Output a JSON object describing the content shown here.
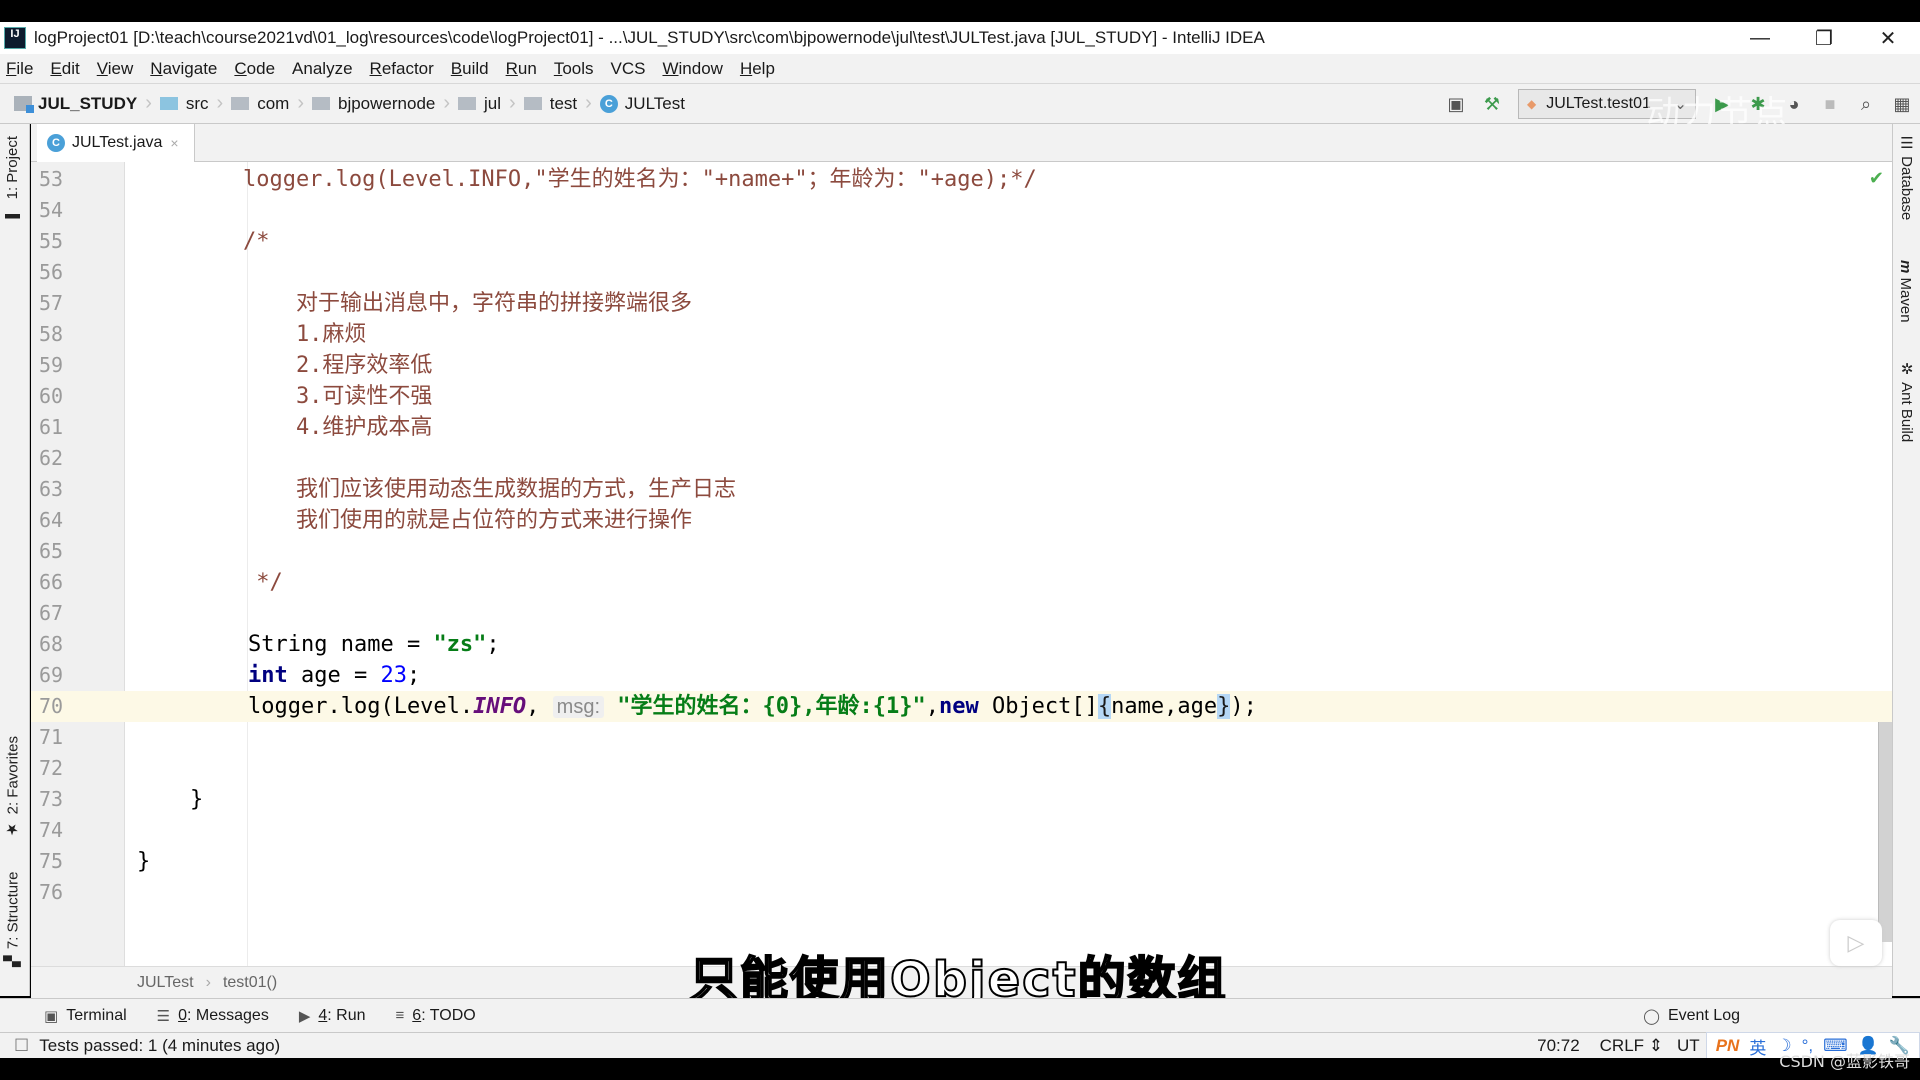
{
  "window": {
    "title": "logProject01 [D:\\teach\\course2021vd\\01_log\\resources\\code\\logProject01] - ...\\JUL_STUDY\\src\\com\\bjpowernode\\jul\\test\\JULTest.java [JUL_STUDY] - IntelliJ IDEA",
    "app_logo": "IJ",
    "controls": {
      "minimize": "—",
      "restore": "❐",
      "close": "✕"
    }
  },
  "menu": [
    {
      "label": "File",
      "mnemonic": "F",
      "rest": "ile"
    },
    {
      "label": "Edit",
      "mnemonic": "E",
      "rest": "dit"
    },
    {
      "label": "View",
      "mnemonic": "V",
      "rest": "iew"
    },
    {
      "label": "Navigate",
      "mnemonic": "N",
      "rest": "avigate"
    },
    {
      "label": "Code",
      "mnemonic": "C",
      "rest": "ode"
    },
    {
      "label": "Analyze",
      "mnemonic": "",
      "rest": "Analyze"
    },
    {
      "label": "Refactor",
      "mnemonic": "R",
      "rest": "efactor"
    },
    {
      "label": "Build",
      "mnemonic": "B",
      "rest": "uild"
    },
    {
      "label": "Run",
      "mnemonic": "R",
      "rest": "un"
    },
    {
      "label": "Tools",
      "mnemonic": "T",
      "rest": "ools"
    },
    {
      "label": "VCS",
      "mnemonic": "",
      "rest": "VCS"
    },
    {
      "label": "Window",
      "mnemonic": "W",
      "rest": "indow"
    },
    {
      "label": "Help",
      "mnemonic": "H",
      "rest": "elp"
    }
  ],
  "nav": {
    "crumbs": [
      "JUL_STUDY",
      "src",
      "com",
      "bjpowernode",
      "jul",
      "test",
      "JULTest"
    ],
    "run_config": "JULTest.test01",
    "watermark": "动力节点"
  },
  "tool_strips": {
    "left": [
      "1: Project",
      "2: Favorites",
      "7: Structure"
    ],
    "right": [
      "Database",
      "Maven",
      "Ant Build"
    ]
  },
  "editor_tab": {
    "label": "JULTest.java",
    "close": "×"
  },
  "code": {
    "current_line": 70,
    "lines": [
      {
        "n": "53",
        "text": "        logger.log(Level.INFO,\"学生的姓名为：\"+name+\"；年龄为：\"+age);*/"
      },
      {
        "n": "54",
        "text": ""
      },
      {
        "n": "55",
        "text": "        /*"
      },
      {
        "n": "56",
        "text": ""
      },
      {
        "n": "57",
        "text": "            对于输出消息中，字符串的拼接弊端很多"
      },
      {
        "n": "58",
        "text": "            1.麻烦"
      },
      {
        "n": "59",
        "text": "            2.程序效率低"
      },
      {
        "n": "60",
        "text": "            3.可读性不强"
      },
      {
        "n": "61",
        "text": "            4.维护成本高"
      },
      {
        "n": "62",
        "text": ""
      },
      {
        "n": "63",
        "text": "            我们应该使用动态生成数据的方式，生产日志"
      },
      {
        "n": "64",
        "text": "            我们使用的就是占位符的方式来进行操作"
      },
      {
        "n": "65",
        "text": ""
      },
      {
        "n": "66",
        "text": "         */"
      },
      {
        "n": "67",
        "text": ""
      },
      {
        "n": "68",
        "parts": [
          "String name = ",
          "\"zs\"",
          ";"
        ]
      },
      {
        "n": "69",
        "parts": [
          "int",
          " age = ",
          "23",
          ";"
        ]
      },
      {
        "n": "70",
        "parts": [
          "logger.log(Level.",
          "INFO",
          ", ",
          "msg:",
          " ",
          "\"学生的姓名：{0},年龄:{1}\"",
          ",",
          "new",
          " Object[]",
          "{",
          "name,age",
          "}",
          ");"
        ]
      },
      {
        "n": "71",
        "text": ""
      },
      {
        "n": "72",
        "text": ""
      },
      {
        "n": "73",
        "text": "    }"
      },
      {
        "n": "74",
        "text": ""
      },
      {
        "n": "75",
        "text": "}"
      },
      {
        "n": "76",
        "text": ""
      }
    ]
  },
  "editor_breadcrumb": {
    "class": "JULTest",
    "method": "test01()"
  },
  "subtitle": "只能使用Object的数组",
  "tool_windows": [
    {
      "num": "",
      "label": "Terminal",
      "icon": "terminal-icon"
    },
    {
      "num": "0",
      "label": ": Messages",
      "icon": "messages-icon"
    },
    {
      "num": "4",
      "label": ": Run",
      "icon": "run-icon"
    },
    {
      "num": "6",
      "label": ": TODO",
      "icon": "todo-icon"
    }
  ],
  "event_log": "Event Log",
  "status": {
    "message": "Tests passed: 1 (4 minutes ago)",
    "position": "70:72",
    "line_sep": "CRLF",
    "encoding": "UT",
    "ime": [
      "PN",
      "英",
      "☽",
      "°,",
      "⌨",
      "👤",
      "🔧"
    ]
  },
  "overlay": {
    "credit": "CSDN @蓝影铁哥"
  }
}
